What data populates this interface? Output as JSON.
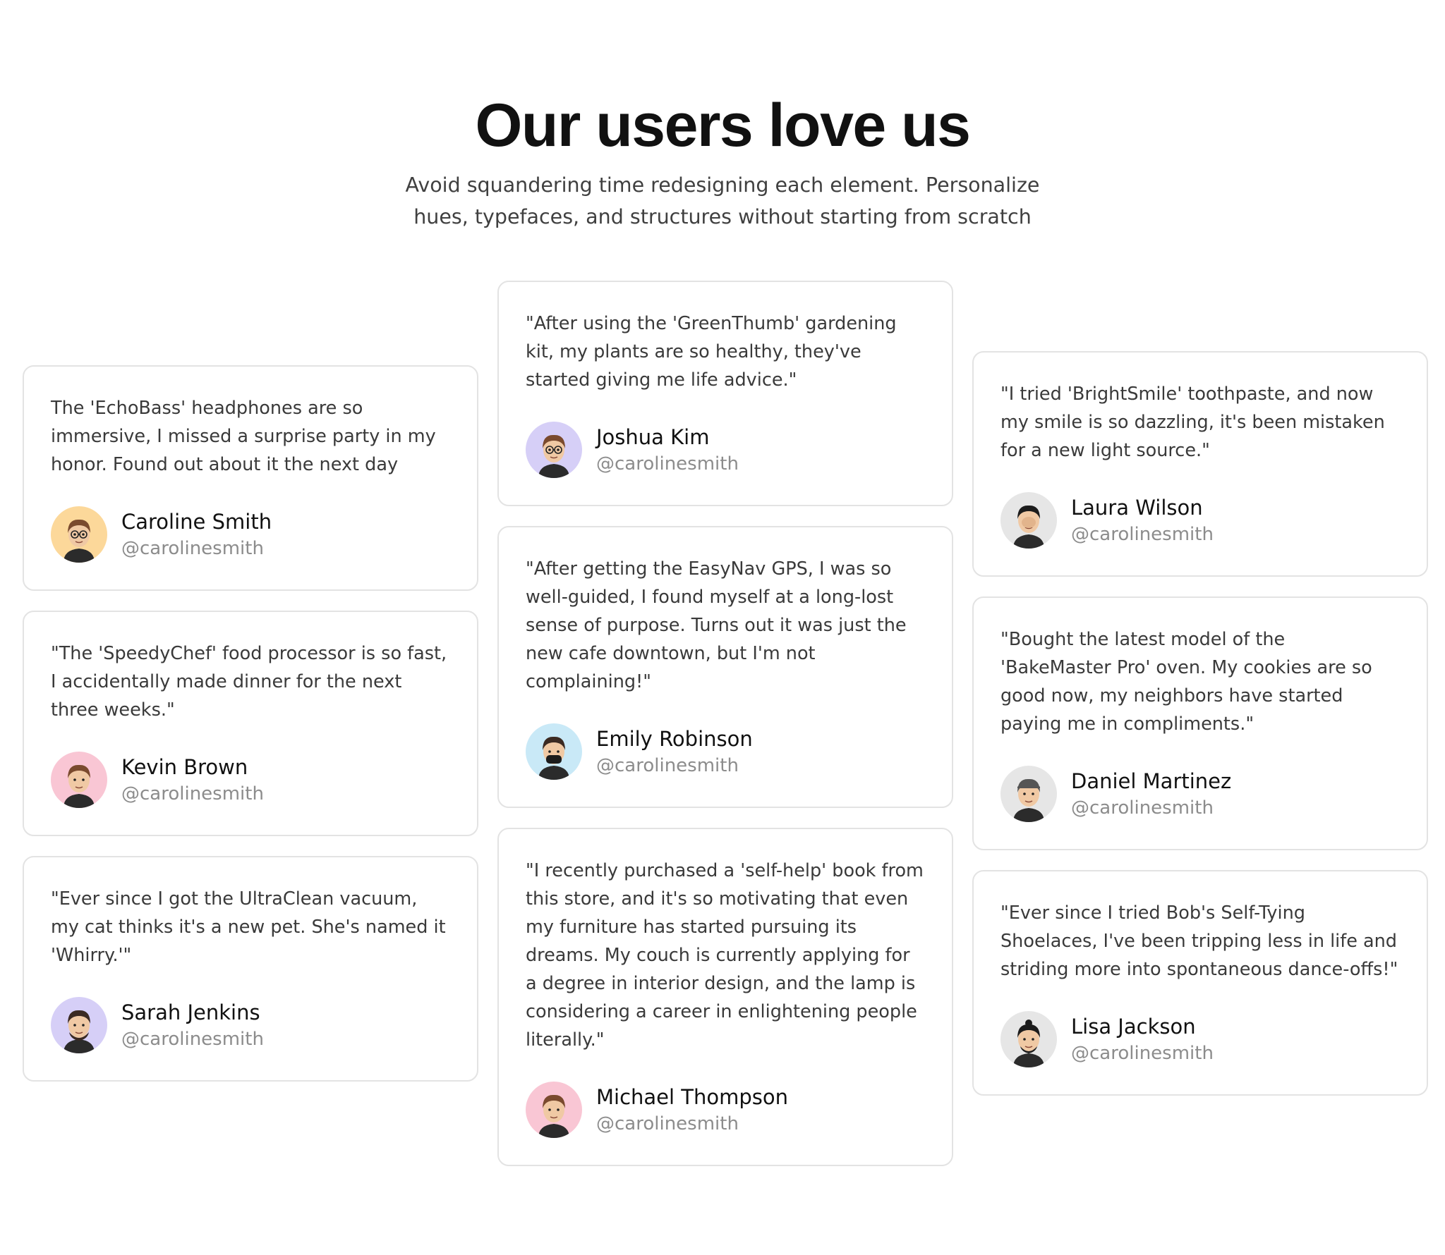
{
  "header": {
    "title": "Our users love us",
    "subtitle": "Avoid squandering time redesigning each element. Personalize hues, typefaces, and structures without starting from scratch"
  },
  "columns": [
    {
      "cards": [
        {
          "quote": "The 'EchoBass' headphones are so immersive, I missed a surprise party in my honor. Found out about it the next day",
          "name": "Caroline Smith",
          "handle": "@carolinesmith",
          "avatar_icon": "memoji-woman-glasses-icon",
          "avatar_bg": "#fcd89a"
        },
        {
          "quote": "\"The 'SpeedyChef' food processor is so fast, I accidentally made dinner for the next three weeks.\"",
          "name": "Kevin Brown",
          "handle": "@carolinesmith",
          "avatar_icon": "memoji-woman-thumbs-up-icon",
          "avatar_bg": "#f9c6d4"
        },
        {
          "quote": "\"Ever since I got the UltraClean vacuum, my cat thinks it's a new pet. She's named it 'Whirry.'\"",
          "name": "Sarah Jenkins",
          "handle": "@carolinesmith",
          "avatar_icon": "memoji-man-beard-icon",
          "avatar_bg": "#d6cff7"
        }
      ]
    },
    {
      "cards": [
        {
          "quote": "\"After using the 'GreenThumb' gardening kit, my plants are so healthy, they've started giving me life advice.\"",
          "name": "Joshua Kim",
          "handle": "@carolinesmith",
          "avatar_icon": "memoji-man-glasses-peace-icon",
          "avatar_bg": "#d6cff7"
        },
        {
          "quote": "\"After getting the EasyNav GPS, I was so well-guided, I found myself at a long-lost sense of purpose. Turns out it was just the new cafe downtown, but I'm not complaining!\"",
          "name": "Emily Robinson",
          "handle": "@carolinesmith",
          "avatar_icon": "memoji-man-mask-icon",
          "avatar_bg": "#c9e9f7"
        },
        {
          "quote": "\"I recently purchased a 'self-help' book from this store, and it's so motivating that even my furniture has started pursuing its dreams. My couch is currently applying for a degree in interior design, and the lamp is considering a career in enlightening people literally.\"",
          "name": "Michael Thompson",
          "handle": "@carolinesmith",
          "avatar_icon": "memoji-woman-wave-icon",
          "avatar_bg": "#f9c6d4"
        }
      ]
    },
    {
      "cards": [
        {
          "quote": "\"I tried 'BrightSmile' toothpaste, and now my smile is so dazzling, it's been mistaken for a new light source.\"",
          "name": "Laura Wilson",
          "handle": "@carolinesmith",
          "avatar_icon": "memoji-facepalm-icon",
          "avatar_bg": "#e6e6e6"
        },
        {
          "quote": "\"Bought the latest model of the 'BakeMaster Pro' oven. My cookies are so good now, my neighbors have started paying me in compliments.\"",
          "name": "Daniel Martinez",
          "handle": "@carolinesmith",
          "avatar_icon": "memoji-man-cap-icon",
          "avatar_bg": "#e6e6e6"
        },
        {
          "quote": "\"Ever since I tried Bob's Self-Tying Shoelaces, I've been tripping less in life and striding more into spontaneous dance-offs!\"",
          "name": "Lisa Jackson",
          "handle": "@carolinesmith",
          "avatar_icon": "memoji-man-bun-icon",
          "avatar_bg": "#e6e6e6"
        }
      ]
    }
  ]
}
